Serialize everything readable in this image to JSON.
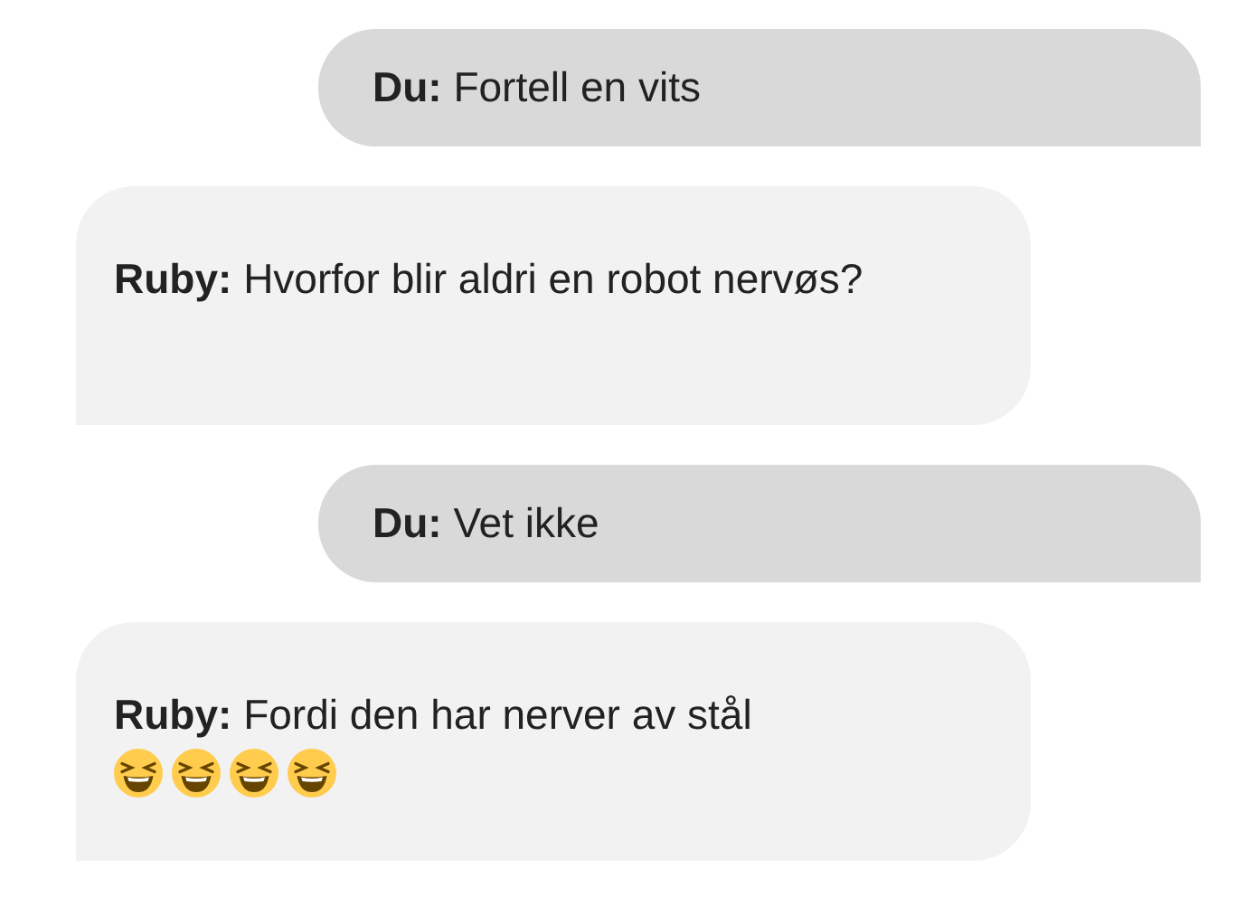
{
  "messages": [
    {
      "kind": "user",
      "sender": "Du:",
      "text": "Fortell en vits"
    },
    {
      "kind": "bot",
      "sender": "Ruby:",
      "text": "Hvorfor blir aldri en robot nervøs?"
    },
    {
      "kind": "user",
      "sender": "Du:",
      "text": "Vet ikke"
    },
    {
      "kind": "bot",
      "sender": "Ruby:",
      "text": "Fordi den har nerver av stål",
      "emojis": [
        {
          "kind": "laughing"
        },
        {
          "kind": "laughing"
        },
        {
          "kind": "laughing"
        },
        {
          "kind": "laughing"
        }
      ]
    }
  ]
}
